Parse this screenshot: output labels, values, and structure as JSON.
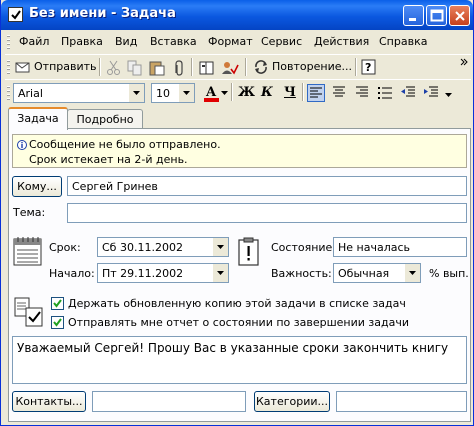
{
  "window": {
    "title": "Без имени - Задача",
    "minimize_icon": "minimize-icon",
    "maximize_icon": "maximize-icon",
    "close_icon": "close-icon"
  },
  "menu": [
    {
      "label": "Файл"
    },
    {
      "label": "Правка"
    },
    {
      "label": "Вид"
    },
    {
      "label": "Вставка"
    },
    {
      "label": "Формат"
    },
    {
      "label": "Сервис"
    },
    {
      "label": "Действия"
    },
    {
      "label": "Справка"
    }
  ],
  "toolbar": {
    "send_label": "Отправить",
    "recurrence_label": "Повторение..."
  },
  "format": {
    "font": "Arial",
    "size": "10",
    "bold": "Ж",
    "italic": "К",
    "underline": "Ч"
  },
  "tabs": [
    {
      "label": "Задача",
      "active": true
    },
    {
      "label": "Подробно",
      "active": false
    }
  ],
  "info": {
    "line1": "Сообщение не было отправлено.",
    "line2": "Срок истекает на 2-й день."
  },
  "to": {
    "button": "Кому...",
    "value": "Сергей Гринев"
  },
  "subject": {
    "label": "Тема:",
    "value": ""
  },
  "due": {
    "label": "Срок:",
    "value": "Сб 30.11.2002"
  },
  "start": {
    "label": "Начало:",
    "value": "Пт 29.11.2002"
  },
  "status": {
    "label": "Состояние:",
    "value": "Не началась"
  },
  "priority": {
    "label": "Важность:",
    "value": "Обычная",
    "percent_label": "% вып."
  },
  "options": {
    "keep_copy": "Держать обновленную копию этой задачи в списке задач",
    "send_report": "Отправлять мне отчет о состоянии по завершении задачи"
  },
  "body": {
    "text": "Уважаемый Сергей! Прошу Вас в указанные сроки закончить книгу"
  },
  "footer": {
    "contacts_button": "Контакты...",
    "contacts_value": "",
    "categories_button": "Категории...",
    "categories_value": ""
  }
}
